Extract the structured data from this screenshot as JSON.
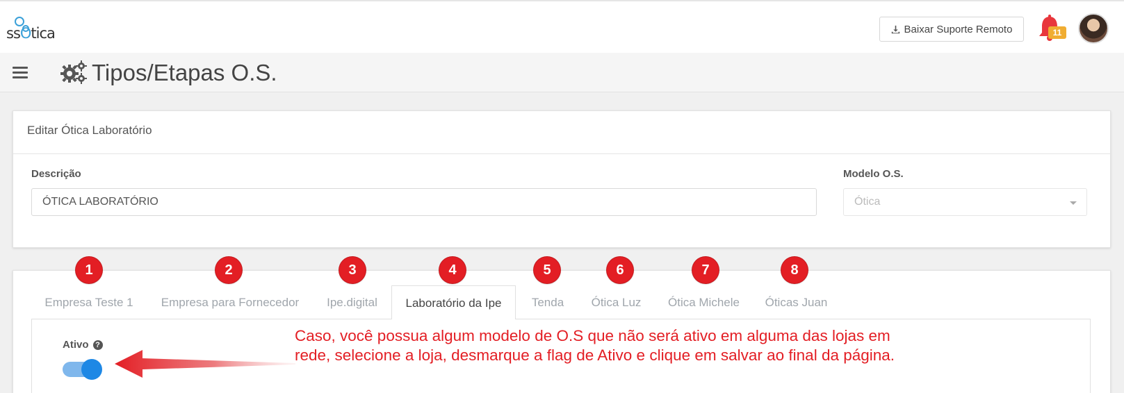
{
  "header": {
    "logo_text": "ssOtica",
    "suporte_label": "Baixar Suporte Remoto",
    "notifications_count": "11"
  },
  "titlebar": {
    "title": "Tipos/Etapas O.S."
  },
  "form": {
    "heading": "Editar Ótica Laboratório",
    "descricao_label": "Descrição",
    "descricao_value": "ÓTICA LABORATÓRIO",
    "modelo_label": "Modelo O.S.",
    "modelo_value": "Ótica"
  },
  "tabs": [
    {
      "label": "Empresa Teste 1",
      "marker": "1"
    },
    {
      "label": "Empresa para Fornecedor",
      "marker": "2"
    },
    {
      "label": "Ipe.digital",
      "marker": "3"
    },
    {
      "label": "Laboratório da Ipe",
      "marker": "4",
      "active": true
    },
    {
      "label": "Tenda",
      "marker": "5"
    },
    {
      "label": "Ótica Luz",
      "marker": "6"
    },
    {
      "label": "Ótica Michele",
      "marker": "7"
    },
    {
      "label": "Óticas Juan",
      "marker": "8"
    }
  ],
  "tab_content": {
    "ativo_label": "Ativo",
    "ativo_on": true
  },
  "annotation": {
    "line1": "Caso, você possua algum modelo de O.S que não será ativo em alguma das lojas em",
    "line2": "rede, selecione a loja, desmarque a flag de Ativo e clique em salvar ao final da página."
  },
  "colors": {
    "annotation": "#e31e24",
    "toggle": "#1e88e5",
    "badge": "#f0ad32",
    "bell": "#e8363c"
  }
}
